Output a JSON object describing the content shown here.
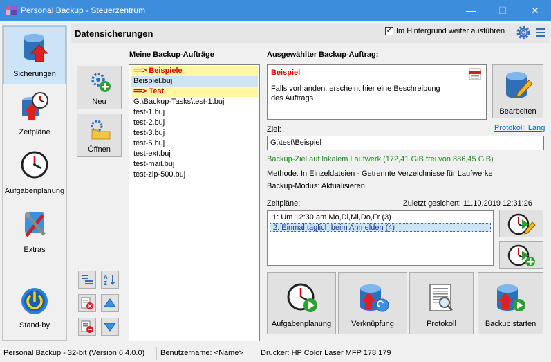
{
  "window": {
    "title": "Personal Backup - Steuerzentrum"
  },
  "nav": {
    "items": [
      {
        "label": "Sicherungen",
        "icon": "database-upload-icon",
        "active": true
      },
      {
        "label": "Zeitpläne",
        "icon": "calendar-clock-icon"
      },
      {
        "label": "Aufgabenplanung",
        "icon": "clock-icon"
      },
      {
        "label": "Extras",
        "icon": "tools-icon"
      }
    ],
    "standby_label": "Stand-by"
  },
  "header": {
    "title": "Datensicherungen",
    "background_label": "Im Hintergrund weiter ausführen",
    "background_checked": true
  },
  "toolbar": {
    "new_label": "Neu",
    "open_label": "Öffnen"
  },
  "jobs": {
    "label": "Meine Backup-Aufträge",
    "rows": [
      {
        "text": "==> Beispiele",
        "kind": "group"
      },
      {
        "text": "Beispiel.buj",
        "kind": "sel"
      },
      {
        "text": "==> Test",
        "kind": "group"
      },
      {
        "text": "G:\\Backup-Tasks\\test-1.buj",
        "kind": "item"
      },
      {
        "text": "test-1.buj",
        "kind": "item"
      },
      {
        "text": "test-2.buj",
        "kind": "item"
      },
      {
        "text": "test-3.buj",
        "kind": "item"
      },
      {
        "text": "test-5.buj",
        "kind": "item"
      },
      {
        "text": "test-ext.buj",
        "kind": "item"
      },
      {
        "text": "test-mail.buj",
        "kind": "item"
      },
      {
        "text": "test-zip-500.buj",
        "kind": "item"
      }
    ]
  },
  "selected": {
    "label": "Ausgewählter Backup-Auftrag:",
    "name": "Beispiel",
    "description": "Falls vorhanden, erscheint hier eine Beschreibung des Auftrags",
    "edit_label": "Bearbeiten",
    "protocol_link": "Protokoll: Lang",
    "target_label": "Ziel:",
    "target_value": "G:\\test\\Beispiel",
    "target_status": "Backup-Ziel auf lokalem Laufwerk (172,41 GiB frei von 886,45 GiB)",
    "method": "Methode: In Einzeldateien - Getrennte Verzeichnisse für Laufwerke",
    "mode": "Backup-Modus: Aktualisieren"
  },
  "schedules": {
    "label": "Zeitpläne:",
    "last_saved": "Zuletzt gesichert: 11.10.2019 12:31:26",
    "rows": [
      {
        "text": "1: Um 12:30 am Mo,Di,Mi,Do,Fr (3)",
        "selected": false
      },
      {
        "text": "2: Einmal täglich beim Anmelden (4)",
        "selected": true
      }
    ]
  },
  "actions": {
    "task_planning": "Aufgabenplanung",
    "shortcut": "Verknüpfung",
    "protocol": "Protokoll",
    "start_backup": "Backup starten"
  },
  "status": {
    "version": "Personal Backup - 32-bit (Version 6.4.0.0)",
    "user": "Benutzername: <Name>",
    "printer": "Drucker: HP Color Laser MFP 178 179"
  },
  "colors": {
    "titlebar": "#3c8ddc",
    "group_bg": "#fff8a0",
    "group_text": "#e00000",
    "selection": "#cfe3f7",
    "link": "#0066cc",
    "status_green": "#1a8a1a"
  }
}
